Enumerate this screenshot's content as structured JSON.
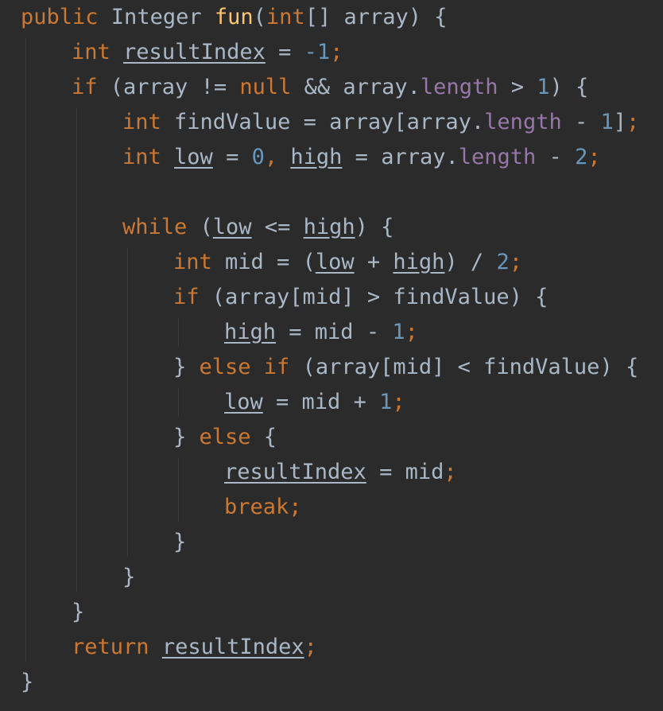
{
  "editor": {
    "theme": {
      "background": "#2b2b2b",
      "keyword": "#cc7832",
      "method": "#ffc66d",
      "number": "#6897bb",
      "field": "#9876aa",
      "text": "#a9b7c6"
    },
    "lines": [
      {
        "indent": 0,
        "tokens": [
          {
            "t": "public",
            "c": "kw"
          },
          {
            "t": " Integer ",
            "c": "var"
          },
          {
            "t": "fun",
            "c": "fn"
          },
          {
            "t": "(",
            "c": "op"
          },
          {
            "t": "int",
            "c": "kw"
          },
          {
            "t": "[] array) {",
            "c": "op"
          }
        ]
      },
      {
        "indent": 1,
        "tokens": [
          {
            "t": "int",
            "c": "kw"
          },
          {
            "t": " ",
            "c": "var"
          },
          {
            "t": "resultIndex",
            "c": "uvar"
          },
          {
            "t": " = ",
            "c": "op"
          },
          {
            "t": "-1",
            "c": "num"
          },
          {
            "t": ";",
            "c": "pun"
          }
        ]
      },
      {
        "indent": 1,
        "tokens": [
          {
            "t": "if",
            "c": "kw"
          },
          {
            "t": " (array != ",
            "c": "op"
          },
          {
            "t": "null",
            "c": "kw"
          },
          {
            "t": " && array.",
            "c": "op"
          },
          {
            "t": "length",
            "c": "fld"
          },
          {
            "t": " > ",
            "c": "op"
          },
          {
            "t": "1",
            "c": "num"
          },
          {
            "t": ") {",
            "c": "op"
          }
        ]
      },
      {
        "indent": 2,
        "tokens": [
          {
            "t": "int",
            "c": "kw"
          },
          {
            "t": " findValue = array[array.",
            "c": "op"
          },
          {
            "t": "length",
            "c": "fld"
          },
          {
            "t": " - ",
            "c": "op"
          },
          {
            "t": "1",
            "c": "num"
          },
          {
            "t": "]",
            "c": "op"
          },
          {
            "t": ";",
            "c": "pun"
          }
        ]
      },
      {
        "indent": 2,
        "tokens": [
          {
            "t": "int",
            "c": "kw"
          },
          {
            "t": " ",
            "c": "var"
          },
          {
            "t": "low",
            "c": "uvar"
          },
          {
            "t": " = ",
            "c": "op"
          },
          {
            "t": "0",
            "c": "num"
          },
          {
            "t": ", ",
            "c": "pun"
          },
          {
            "t": "high",
            "c": "uvar"
          },
          {
            "t": " = array.",
            "c": "op"
          },
          {
            "t": "length",
            "c": "fld"
          },
          {
            "t": " - ",
            "c": "op"
          },
          {
            "t": "2",
            "c": "num"
          },
          {
            "t": ";",
            "c": "pun"
          }
        ]
      },
      {
        "indent": 0,
        "tokens": []
      },
      {
        "indent": 2,
        "tokens": [
          {
            "t": "while",
            "c": "kw"
          },
          {
            "t": " (",
            "c": "op"
          },
          {
            "t": "low",
            "c": "uvar"
          },
          {
            "t": " <= ",
            "c": "op"
          },
          {
            "t": "high",
            "c": "uvar"
          },
          {
            "t": ") {",
            "c": "op"
          }
        ]
      },
      {
        "indent": 3,
        "tokens": [
          {
            "t": "int",
            "c": "kw"
          },
          {
            "t": " mid = (",
            "c": "op"
          },
          {
            "t": "low",
            "c": "uvar"
          },
          {
            "t": " + ",
            "c": "op"
          },
          {
            "t": "high",
            "c": "uvar"
          },
          {
            "t": ") / ",
            "c": "op"
          },
          {
            "t": "2",
            "c": "num"
          },
          {
            "t": ";",
            "c": "pun"
          }
        ]
      },
      {
        "indent": 3,
        "tokens": [
          {
            "t": "if",
            "c": "kw"
          },
          {
            "t": " (array[mid] > findValue) {",
            "c": "op"
          }
        ]
      },
      {
        "indent": 4,
        "tokens": [
          {
            "t": "high",
            "c": "uvar"
          },
          {
            "t": " = mid - ",
            "c": "op"
          },
          {
            "t": "1",
            "c": "num"
          },
          {
            "t": ";",
            "c": "pun"
          }
        ]
      },
      {
        "indent": 3,
        "tokens": [
          {
            "t": "} ",
            "c": "op"
          },
          {
            "t": "else if",
            "c": "kw"
          },
          {
            "t": " (array[mid] < findValue) {",
            "c": "op"
          }
        ]
      },
      {
        "indent": 4,
        "tokens": [
          {
            "t": "low",
            "c": "uvar"
          },
          {
            "t": " = mid + ",
            "c": "op"
          },
          {
            "t": "1",
            "c": "num"
          },
          {
            "t": ";",
            "c": "pun"
          }
        ]
      },
      {
        "indent": 3,
        "tokens": [
          {
            "t": "} ",
            "c": "op"
          },
          {
            "t": "else",
            "c": "kw"
          },
          {
            "t": " {",
            "c": "op"
          }
        ]
      },
      {
        "indent": 4,
        "tokens": [
          {
            "t": "resultIndex",
            "c": "uvar"
          },
          {
            "t": " = mid",
            "c": "op"
          },
          {
            "t": ";",
            "c": "pun"
          }
        ]
      },
      {
        "indent": 4,
        "tokens": [
          {
            "t": "break",
            "c": "kw"
          },
          {
            "t": ";",
            "c": "pun"
          }
        ]
      },
      {
        "indent": 3,
        "tokens": [
          {
            "t": "}",
            "c": "op"
          }
        ]
      },
      {
        "indent": 2,
        "tokens": [
          {
            "t": "}",
            "c": "op"
          }
        ]
      },
      {
        "indent": 1,
        "tokens": [
          {
            "t": "}",
            "c": "op"
          }
        ]
      },
      {
        "indent": 1,
        "tokens": [
          {
            "t": "return",
            "c": "kw"
          },
          {
            "t": " ",
            "c": "var"
          },
          {
            "t": "resultIndex",
            "c": "uvar"
          },
          {
            "t": ";",
            "c": "pun"
          }
        ]
      },
      {
        "indent": 0,
        "tokens": [
          {
            "t": "}",
            "c": "op"
          }
        ]
      }
    ]
  }
}
